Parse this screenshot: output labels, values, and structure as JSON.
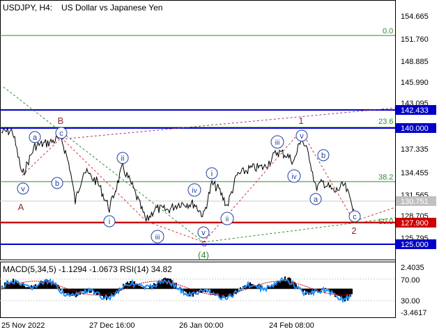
{
  "header": {
    "symbol_timeframe": "USDJPY, H4:",
    "instrument_name": "US Dollar vs Japanese Yen"
  },
  "colors": {
    "price_line": "#000000",
    "blue_level": "#0000c8",
    "red_level": "#cc0000",
    "fib_green": "#2e8b2e",
    "wave_blue": "#1e3fa0",
    "wave_red": "#8b2a2a",
    "rsi_line": "#1e90ff",
    "grid": "#c8c8c8"
  },
  "price_axis": {
    "ticks": [
      "154.665",
      "151.760",
      "148.885",
      "145.990",
      "143.095",
      "140.000",
      "137.335",
      "134.455",
      "131.565",
      "128.705",
      "125.795"
    ],
    "labels": [
      {
        "name": "level-142433",
        "text": "142.433",
        "color": "#0000c8"
      },
      {
        "name": "level-140000",
        "text": "140.000",
        "color": "#0000c8"
      },
      {
        "name": "current-price",
        "text": "130.751",
        "color": "#c0c0c0"
      },
      {
        "name": "level-127900",
        "text": "127.900",
        "color": "#cc0000"
      },
      {
        "name": "level-125000",
        "text": "125.000",
        "color": "#0000c8"
      }
    ]
  },
  "fib_levels": [
    "0.0",
    "23.6",
    "38.2",
    "50.0"
  ],
  "wave_labels": {
    "blue_circled": [
      "v",
      "a",
      "c",
      "b",
      "ii",
      "i",
      "iii",
      "iv",
      "v",
      "i",
      "ii",
      "iii",
      "iv",
      "v",
      "b",
      "a",
      "c"
    ],
    "red": [
      "B",
      "A",
      "C",
      "1",
      "2"
    ],
    "green": [
      "(4)"
    ]
  },
  "indicator": {
    "title": "MACD(5,34,5) -1.1294 -1.0673 RSI(14) 34.82",
    "ticks": [
      "2.4035",
      "70.00",
      "30.00",
      "-3.4617"
    ]
  },
  "time_axis": [
    "25 Nov 2022",
    "27 Dec 16:00",
    "26 Jan 00:00",
    "24 Feb 08:00"
  ]
}
